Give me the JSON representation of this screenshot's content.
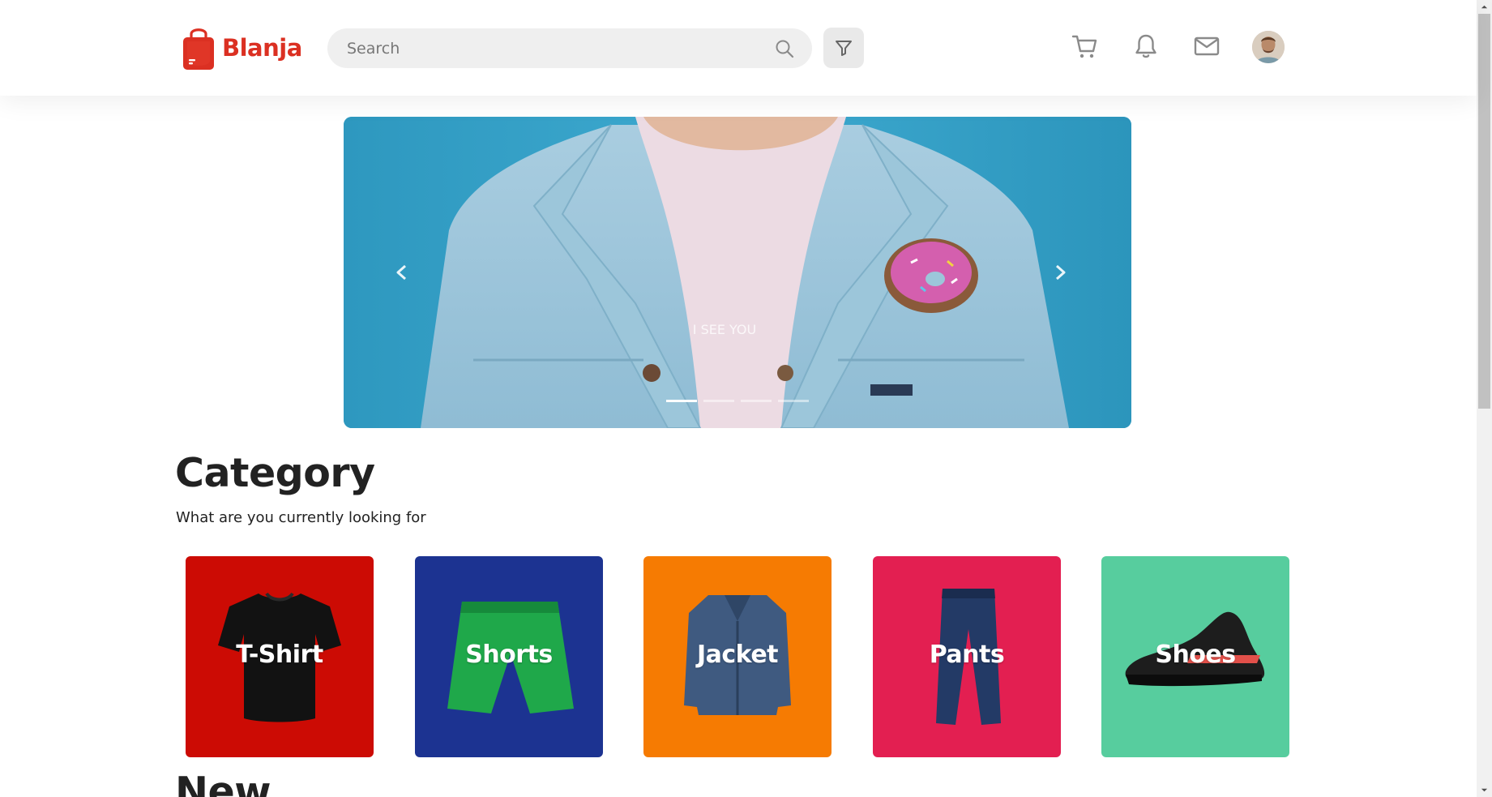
{
  "header": {
    "brand_name": "Blanja",
    "search_placeholder": "Search",
    "icons": [
      "cart-icon",
      "bell-icon",
      "mail-icon"
    ],
    "brand_color": "#DB3022"
  },
  "carousel": {
    "slide_count": 4,
    "active_index": 0,
    "slide_text": "I SEE YOU"
  },
  "category": {
    "title": "Category",
    "subtitle": "What are you currently looking for",
    "items": [
      {
        "label": "T-Shirt",
        "color": "#CC0B04"
      },
      {
        "label": "Shorts",
        "color": "#1C3391"
      },
      {
        "label": "Jacket",
        "color": "#F67B02"
      },
      {
        "label": "Pants",
        "color": "#E31F51"
      },
      {
        "label": "Shoes",
        "color": "#57CD9E"
      }
    ]
  },
  "new_section": {
    "title": "New"
  }
}
